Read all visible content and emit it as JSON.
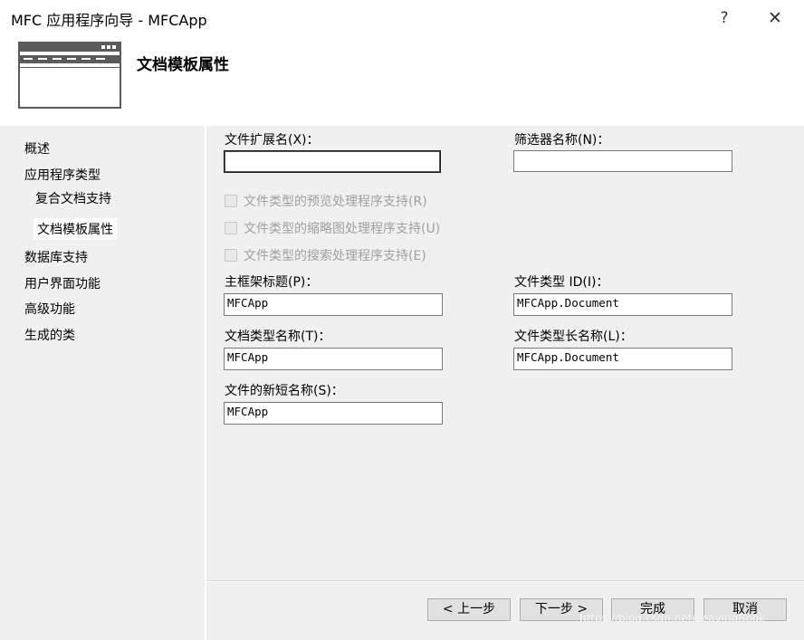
{
  "window": {
    "title": "MFC 应用程序向导 - MFCApp",
    "help_glyph": "?",
    "close_glyph": "✕"
  },
  "header": {
    "heading": "文档模板属性",
    "icon": "window-template-icon"
  },
  "nav": {
    "items": [
      {
        "label": "概述"
      },
      {
        "label": "应用程序类型"
      },
      {
        "label": "复合文档支持"
      },
      {
        "label": "文档模板属性",
        "selected": true
      },
      {
        "label": "数据库支持"
      },
      {
        "label": "用户界面功能"
      },
      {
        "label": "高级功能"
      },
      {
        "label": "生成的类"
      }
    ]
  },
  "form": {
    "file_ext_label": "文件扩展名(X)：",
    "file_ext_value": "",
    "filter_name_label": "筛选器名称(N)：",
    "filter_name_value": "",
    "checkboxes": [
      {
        "label": "文件类型的预览处理程序支持(R)",
        "checked": false,
        "enabled": false
      },
      {
        "label": "文件类型的缩略图处理程序支持(U)",
        "checked": false,
        "enabled": false
      },
      {
        "label": "文件类型的搜索处理程序支持(E)",
        "checked": false,
        "enabled": false
      }
    ],
    "main_frame_title_label": "主框架标题(P)：",
    "main_frame_title_value": "MFCApp",
    "file_type_id_label": "文件类型 ID(I)：",
    "file_type_id_value": "MFCApp.Document",
    "doc_type_name_label": "文档类型名称(T)：",
    "doc_type_name_value": "MFCApp",
    "file_type_long_name_label": "文件类型长名称(L)：",
    "file_type_long_name_value": "MFCApp.Document",
    "file_short_name_label": "文件的新短名称(S)：",
    "file_short_name_value": "MFCApp"
  },
  "buttons": {
    "prev": "< 上一步",
    "next": "下一步 >",
    "finish": "完成",
    "cancel": "取消"
  },
  "watermark": "https://blog.csdn.net/LeavingBook",
  "colors": {
    "panel_bg": "#f0f0f0",
    "button_bg": "#e1e1e1",
    "disabled_text": "#a0a0a0"
  }
}
